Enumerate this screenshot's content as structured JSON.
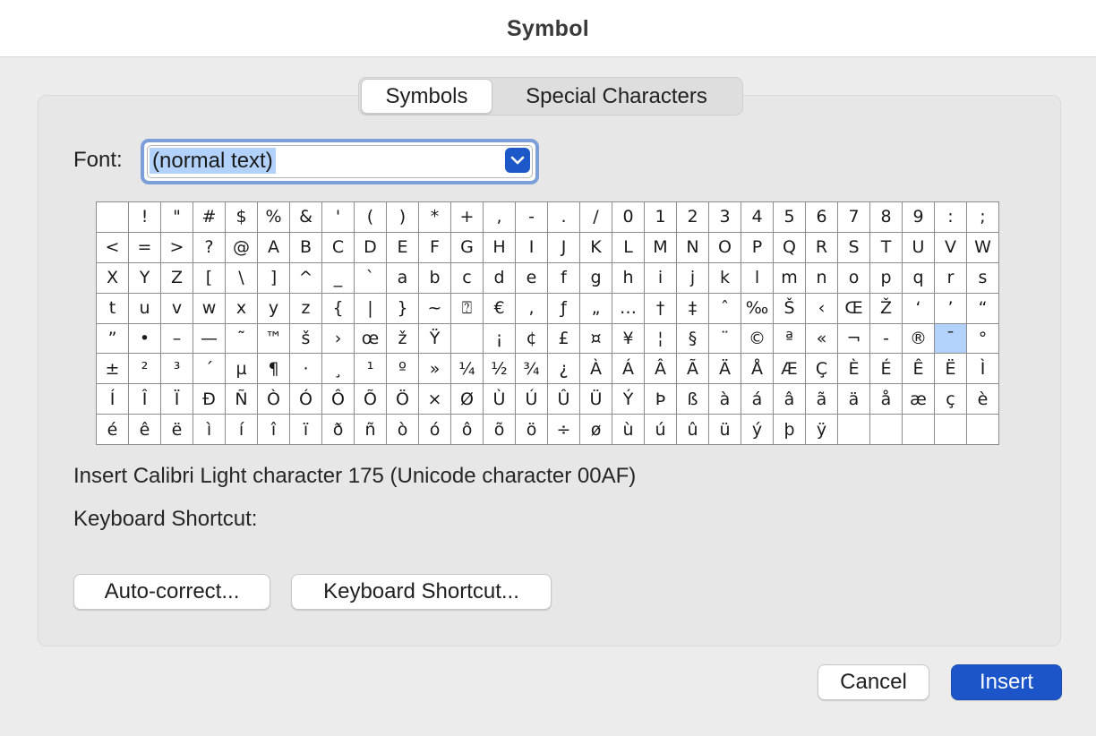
{
  "window": {
    "title": "Symbol"
  },
  "tabs": [
    {
      "label": "Symbols",
      "active": true
    },
    {
      "label": "Special Characters",
      "active": false
    }
  ],
  "font": {
    "label": "Font:",
    "value": "(normal text)"
  },
  "symbol_grid": {
    "rows": [
      [
        "",
        "!",
        "\"",
        "#",
        "$",
        "%",
        "&",
        "'",
        "(",
        ")",
        "*",
        "+",
        ",",
        "-",
        ".",
        "/",
        "0",
        "1",
        "2",
        "3",
        "4",
        "5",
        "6",
        "7",
        "8",
        "9",
        ":",
        ";"
      ],
      [
        "<",
        "=",
        ">",
        "?",
        "@",
        "A",
        "B",
        "C",
        "D",
        "E",
        "F",
        "G",
        "H",
        "I",
        "J",
        "K",
        "L",
        "M",
        "N",
        "O",
        "P",
        "Q",
        "R",
        "S",
        "T",
        "U",
        "V",
        "W"
      ],
      [
        "X",
        "Y",
        "Z",
        "[",
        "\\",
        "]",
        "^",
        "_",
        "`",
        "a",
        "b",
        "c",
        "d",
        "e",
        "f",
        "g",
        "h",
        "i",
        "j",
        "k",
        "l",
        "m",
        "n",
        "o",
        "p",
        "q",
        "r",
        "s"
      ],
      [
        "t",
        "u",
        "v",
        "w",
        "x",
        "y",
        "z",
        "{",
        "|",
        "}",
        "~",
        "⍰",
        "€",
        ",",
        "ƒ",
        "„",
        "…",
        "†",
        "‡",
        "ˆ",
        "‰",
        "Š",
        "‹",
        "Œ",
        "Ž",
        "‘",
        "’",
        "“"
      ],
      [
        "”",
        "•",
        "–",
        "—",
        "˜",
        "™",
        "š",
        "›",
        "œ",
        "ž",
        "Ÿ",
        "",
        "¡",
        "¢",
        "£",
        "¤",
        "¥",
        "¦",
        "§",
        "¨",
        "©",
        "ª",
        "«",
        "¬",
        "-",
        "®",
        "¯",
        "°"
      ],
      [
        "±",
        "²",
        "³",
        "´",
        "µ",
        "¶",
        "·",
        "¸",
        "¹",
        "º",
        "»",
        "¼",
        "½",
        "¾",
        "¿",
        "À",
        "Á",
        "Â",
        "Ã",
        "Ä",
        "Å",
        "Æ",
        "Ç",
        "È",
        "É",
        "Ê",
        "Ë",
        "Ì"
      ],
      [
        "Í",
        "Î",
        "Ï",
        "Ð",
        "Ñ",
        "Ò",
        "Ó",
        "Ô",
        "Õ",
        "Ö",
        "×",
        "Ø",
        "Ù",
        "Ú",
        "Û",
        "Ü",
        "Ý",
        "Þ",
        "ß",
        "à",
        "á",
        "â",
        "ã",
        "ä",
        "å",
        "æ",
        "ç",
        "è"
      ],
      [
        "é",
        "ê",
        "ë",
        "ì",
        "í",
        "î",
        "ï",
        "ð",
        "ñ",
        "ò",
        "ó",
        "ô",
        "õ",
        "ö",
        "÷",
        "ø",
        "ù",
        "ú",
        "û",
        "ü",
        "ý",
        "þ",
        "ÿ",
        "",
        "",
        "",
        "",
        ""
      ]
    ],
    "selected": {
      "row": 4,
      "col": 26
    }
  },
  "info": {
    "description": "Insert Calibri Light character 175 (Unicode character 00AF)",
    "shortcut_label": "Keyboard Shortcut:"
  },
  "buttons": {
    "autocorrect": "Auto-correct...",
    "keyboard_shortcut": "Keyboard Shortcut...",
    "cancel": "Cancel",
    "insert": "Insert"
  },
  "colors": {
    "accent": "#1c55c9",
    "selection": "#b3d2fb",
    "focus_ring": "#7d9fd9"
  },
  "icons": {
    "font_dropdown": "chevron-down-icon"
  }
}
